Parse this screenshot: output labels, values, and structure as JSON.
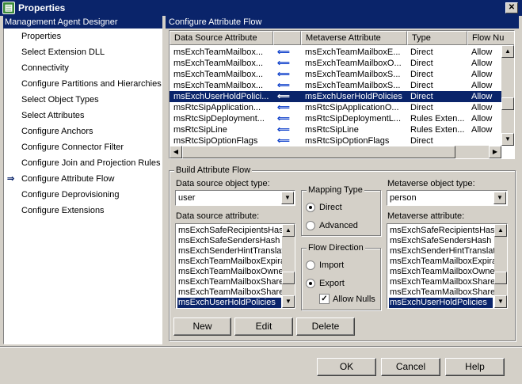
{
  "window": {
    "title": "Properties",
    "close_glyph": "✕",
    "icon": "properties-icon"
  },
  "left_panel": {
    "header": "Management Agent Designer",
    "items": [
      {
        "label": "Properties"
      },
      {
        "label": "Select Extension DLL"
      },
      {
        "label": "Connectivity"
      },
      {
        "label": "Configure Partitions and Hierarchies"
      },
      {
        "label": "Select Object Types"
      },
      {
        "label": "Select Attributes"
      },
      {
        "label": "Configure Anchors"
      },
      {
        "label": "Configure Connector Filter"
      },
      {
        "label": "Configure Join and Projection Rules"
      },
      {
        "label": "Configure Attribute Flow",
        "active": true
      },
      {
        "label": "Configure Deprovisioning"
      },
      {
        "label": "Configure Extensions"
      }
    ]
  },
  "right_panel": {
    "header": "Configure Attribute Flow",
    "grid": {
      "columns": [
        "Data Source Attribute",
        "",
        "Metaverse Attribute",
        "Type",
        "Flow Nu"
      ],
      "rows": [
        [
          "msExchTeamMailbox...",
          "⟸",
          "msExchTeamMailboxE...",
          "Direct",
          "Allow"
        ],
        [
          "msExchTeamMailbox...",
          "⟸",
          "msExchTeamMailboxO...",
          "Direct",
          "Allow"
        ],
        [
          "msExchTeamMailbox...",
          "⟸",
          "msExchTeamMailboxS...",
          "Direct",
          "Allow"
        ],
        [
          "msExchTeamMailbox...",
          "⟸",
          "msExchTeamMailboxS...",
          "Direct",
          "Allow"
        ],
        [
          "msExchUserHoldPolici...",
          "⟸",
          "msExchUserHoldPolicies",
          "Direct",
          "Allow"
        ],
        [
          "msRtcSipApplication...",
          "⟸",
          "msRtcSipApplicationO...",
          "Direct",
          "Allow"
        ],
        [
          "msRtcSipDeployment...",
          "⟸",
          "msRtcSipDeploymentL...",
          "Rules Exten...",
          "Allow"
        ],
        [
          "msRtcSipLine",
          "⟸",
          "msRtcSipLine",
          "Rules Exten...",
          "Allow"
        ],
        [
          "msRtcSipOptionFlags",
          "⟸",
          "msRtcSipOptionFlags",
          "Direct",
          ""
        ]
      ],
      "selected_row": 4
    },
    "build": {
      "title": "Build Attribute Flow",
      "ds_type_label": "Data source object type:",
      "ds_type_value": "user",
      "ds_attr_label": "Data source attribute:",
      "ds_attrs": [
        "msExchSafeRecipientsHash",
        "msExchSafeSendersHash",
        "msExchSenderHintTranslatio",
        "msExchTeamMailboxExpiratio",
        "msExchTeamMailboxOwners",
        "msExchTeamMailboxShareP",
        "msExchTeamMailboxShareP",
        "msExchUserHoldPolicies"
      ],
      "mv_type_label": "Metaverse object type:",
      "mv_type_value": "person",
      "mv_attr_label": "Metaverse attribute:",
      "mv_attrs": [
        "msExchSafeRecipientsHash",
        "msExchSafeSendersHash",
        "msExchSenderHintTranslatio",
        "msExchTeamMailboxExpiratio",
        "msExchTeamMailboxOwners",
        "msExchTeamMailboxShareP",
        "msExchTeamMailboxShareP",
        "msExchUserHoldPolicies"
      ],
      "mapping_type": {
        "title": "Mapping Type",
        "direct": "Direct",
        "advanced": "Advanced",
        "selected": "direct"
      },
      "flow_direction": {
        "title": "Flow Direction",
        "import": "Import",
        "export": "Export",
        "selected": "export",
        "allow_nulls": "Allow Nulls",
        "allow_nulls_checked": true
      },
      "buttons": {
        "new": "New",
        "edit": "Edit",
        "delete": "Delete"
      }
    }
  },
  "footer": {
    "ok": "OK",
    "cancel": "Cancel",
    "help": "Help"
  }
}
